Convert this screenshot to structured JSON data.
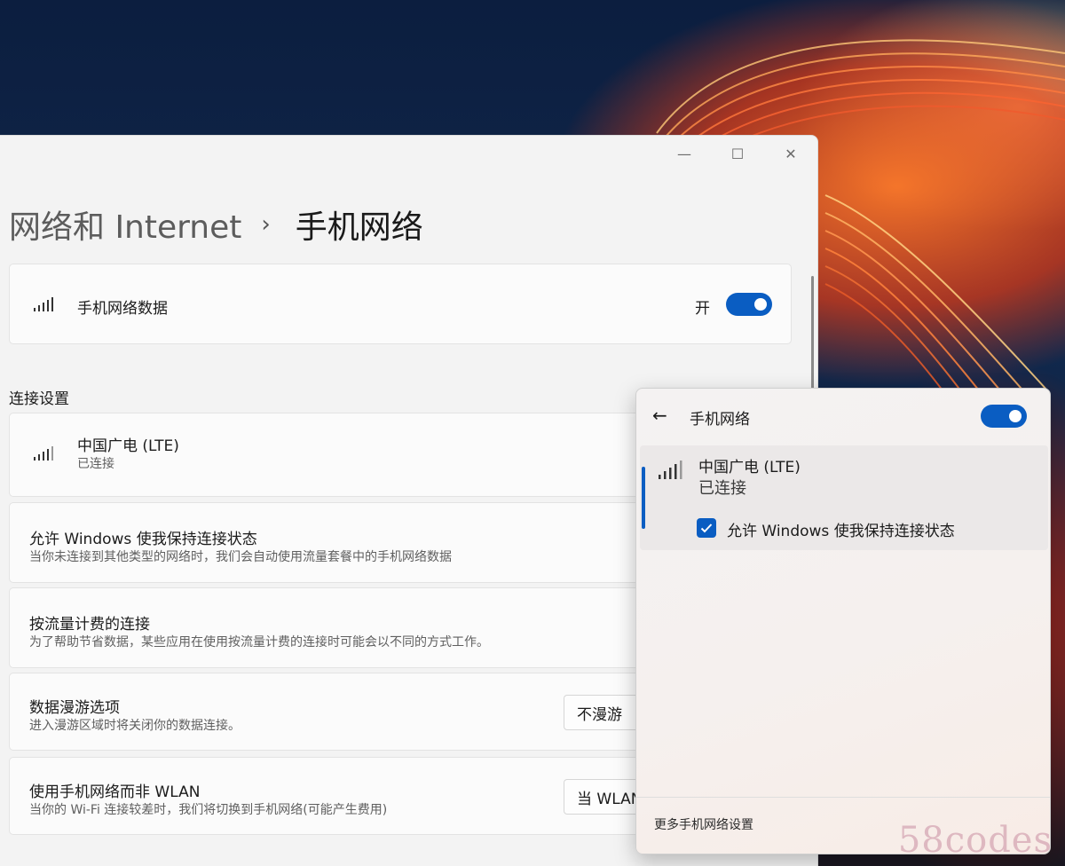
{
  "window": {
    "controls": {
      "minimize": "—",
      "maximize": "☐",
      "close": "✕"
    },
    "breadcrumb": {
      "parent": "网络和 Internet",
      "separator": "›",
      "current": "手机网络"
    }
  },
  "cellular_data": {
    "label": "手机网络数据",
    "toggle_label": "开",
    "enabled": true
  },
  "connection_settings": {
    "heading": "连接设置",
    "carrier": {
      "name": "中国广电 (LTE)",
      "status": "已连接"
    },
    "keep_connected": {
      "title": "允许 Windows 使我保持连接状态",
      "description": "当你未连接到其他类型的网络时，我们会自动使用流量套餐中的手机网络数据"
    },
    "metered": {
      "title": "按流量计费的连接",
      "description": "为了帮助节省数据，某些应用在使用按流量计费的连接时可能会以不同的方式工作。"
    },
    "roaming": {
      "title": "数据漫游选项",
      "description": "进入漫游区域时将关闭你的数据连接。",
      "selected": "不漫游"
    },
    "prefer_cellular": {
      "title": "使用手机网络而非 WLAN",
      "description": "当你的 Wi-Fi 连接较差时，我们将切换到手机网络(可能产生费用)",
      "selected": "当 WLAN"
    }
  },
  "flyout": {
    "back_icon": "←",
    "title": "手机网络",
    "enabled": true,
    "network": {
      "name": "中国广电 (LTE)",
      "status": "已连接",
      "checkbox_label": "允许 Windows 使我保持连接状态",
      "checked": true
    },
    "footer_link": "更多手机网络设置"
  },
  "watermark": "58codes",
  "colors": {
    "accent": "#0a5dc2",
    "window_bg": "#f3f3f3",
    "card_bg": "#fbfbfb"
  }
}
